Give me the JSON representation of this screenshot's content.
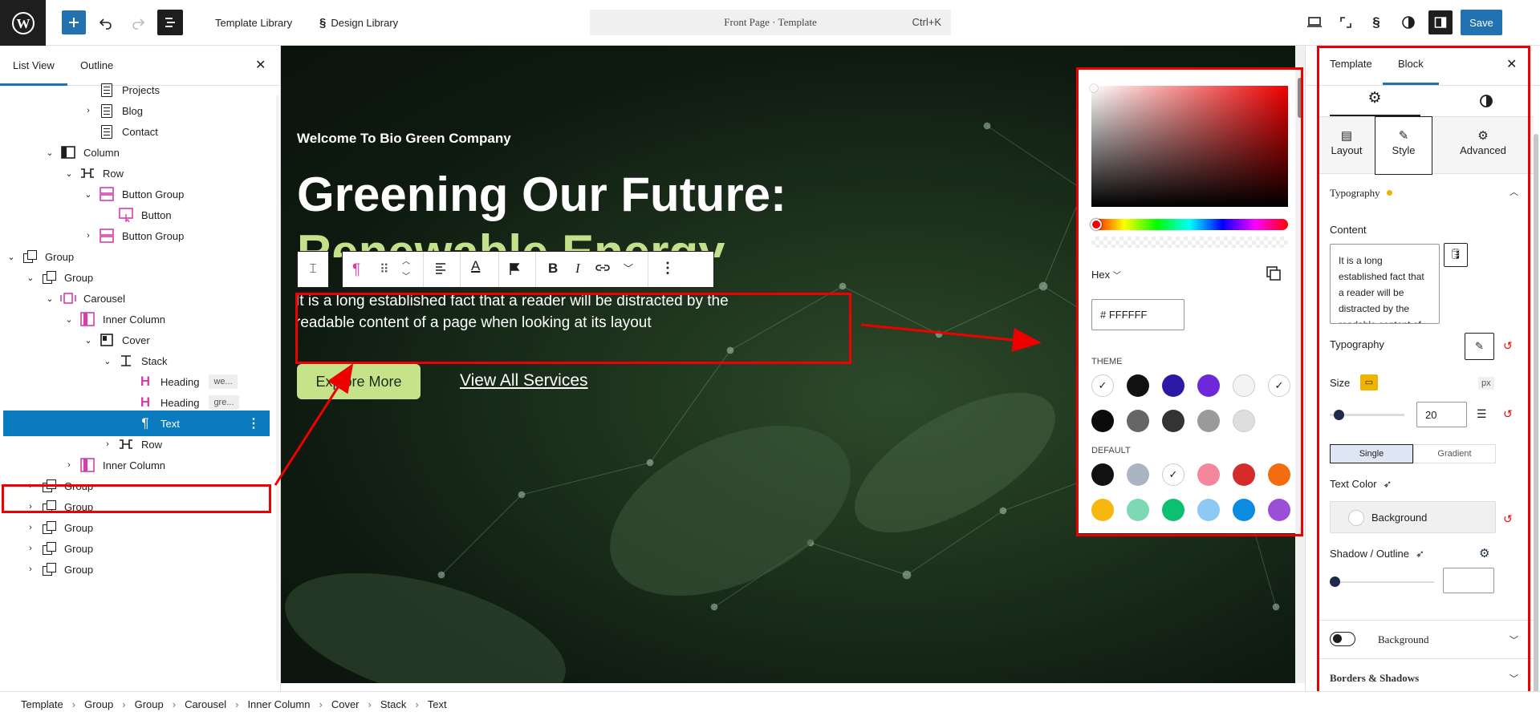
{
  "topbar": {
    "template_library": "Template Library",
    "design_library": "Design Library",
    "command": "Front Page · Template",
    "shortcut": "Ctrl+K",
    "save": "Save"
  },
  "left_panel": {
    "tabs": [
      "List View",
      "Outline"
    ],
    "tree": [
      {
        "label": "Projects",
        "icon": "page-icon",
        "depth": 4,
        "chevron": "",
        "tag": ""
      },
      {
        "label": "Blog",
        "icon": "page-icon",
        "depth": 4,
        "chevron": "›",
        "tag": ""
      },
      {
        "label": "Contact",
        "icon": "page-icon",
        "depth": 4,
        "chevron": "",
        "tag": ""
      },
      {
        "label": "Column",
        "icon": "column-icon",
        "depth": 2,
        "chevron": "⌄",
        "tag": ""
      },
      {
        "label": "Row",
        "icon": "row-icon",
        "depth": 3,
        "chevron": "⌄",
        "tag": ""
      },
      {
        "label": "Button Group",
        "icon": "button-group-icon",
        "depth": 4,
        "chevron": "⌄",
        "tag": ""
      },
      {
        "label": "Button",
        "icon": "button-icon",
        "depth": 5,
        "chevron": "",
        "tag": ""
      },
      {
        "label": "Button Group",
        "icon": "button-group-icon",
        "depth": 4,
        "chevron": "›",
        "tag": ""
      },
      {
        "label": "Group",
        "icon": "group-icon",
        "depth": 0,
        "chevron": "⌄",
        "tag": ""
      },
      {
        "label": "Group",
        "icon": "group-icon",
        "depth": 1,
        "chevron": "⌄",
        "tag": ""
      },
      {
        "label": "Carousel",
        "icon": "carousel-icon",
        "depth": 2,
        "chevron": "⌄",
        "tag": ""
      },
      {
        "label": "Inner Column",
        "icon": "inner-column-icon",
        "depth": 3,
        "chevron": "⌄",
        "tag": ""
      },
      {
        "label": "Cover",
        "icon": "cover-icon",
        "depth": 4,
        "chevron": "⌄",
        "tag": ""
      },
      {
        "label": "Stack",
        "icon": "stack-icon",
        "depth": 5,
        "chevron": "⌄",
        "tag": ""
      },
      {
        "label": "Heading",
        "icon": "heading-icon",
        "depth": 6,
        "chevron": "",
        "tag": "we..."
      },
      {
        "label": "Heading",
        "icon": "heading-icon",
        "depth": 6,
        "chevron": "",
        "tag": "gre..."
      },
      {
        "label": "Text",
        "icon": "paragraph-icon",
        "depth": 6,
        "chevron": "",
        "tag": "",
        "selected": true
      },
      {
        "label": "Row",
        "icon": "row-icon",
        "depth": 5,
        "chevron": "›",
        "tag": ""
      },
      {
        "label": "Inner Column",
        "icon": "inner-column-icon",
        "depth": 3,
        "chevron": "›",
        "tag": ""
      },
      {
        "label": "Group",
        "icon": "group-icon",
        "depth": 1,
        "chevron": "›",
        "tag": ""
      },
      {
        "label": "Group",
        "icon": "group-icon",
        "depth": 1,
        "chevron": "›",
        "tag": ""
      },
      {
        "label": "Group",
        "icon": "group-icon",
        "depth": 1,
        "chevron": "›",
        "tag": ""
      },
      {
        "label": "Group",
        "icon": "group-icon",
        "depth": 1,
        "chevron": "›",
        "tag": ""
      },
      {
        "label": "Group",
        "icon": "group-icon",
        "depth": 1,
        "chevron": "›",
        "tag": ""
      }
    ]
  },
  "canvas": {
    "eyebrow": "Welcome To Bio Green Company",
    "headline_1": "Greening Our Future:",
    "headline_2": "Renewable Energy",
    "paragraph": "It is a long established fact that a reader will be distracted by the readable content of a page when looking at its layout",
    "primary_button": "Explore More",
    "secondary_link": "View All Services"
  },
  "color_picker": {
    "format_label": "Hex",
    "hex_value": "# FFFFFF",
    "theme_label": "THEME",
    "default_label": "DEFAULT",
    "theme_colors": [
      "#ffffff",
      "#111111",
      "#2c1aa6",
      "#6d28d9",
      "#f3f3f3",
      "#ffffff",
      "#0b0b0b",
      "#666666",
      "#333333",
      "#9a9a9a",
      "#dedede"
    ],
    "default_colors": [
      "#111111",
      "#aab4c3",
      "#ffffff",
      "#f4879e",
      "#d62b2b",
      "#f36c0f",
      "#f6b70e",
      "#7ed8b1",
      "#0cbf72",
      "#8ec8f4",
      "#0b8be1",
      "#9b4fd6"
    ]
  },
  "right_panel": {
    "tabs": [
      "Template",
      "Block"
    ],
    "subtabs": [
      "Layout",
      "Style",
      "Advanced"
    ],
    "typography_section": "Typography",
    "content_label": "Content",
    "content_text": "It is a long established fact that a reader will be distracted by the readable content of a page when looking at",
    "typography_label": "Typography",
    "size_label": "Size",
    "size_unit": "px",
    "size_value": "20",
    "color_modes": [
      "Single",
      "Gradient"
    ],
    "text_color_label": "Text Color",
    "background_btn": "Background",
    "shadow_label": "Shadow / Outline",
    "background_toggle_label": "Background",
    "borders_label": "Borders & Shadows"
  },
  "breadcrumb": [
    "Template",
    "Group",
    "Group",
    "Carousel",
    "Inner Column",
    "Cover",
    "Stack",
    "Text"
  ]
}
